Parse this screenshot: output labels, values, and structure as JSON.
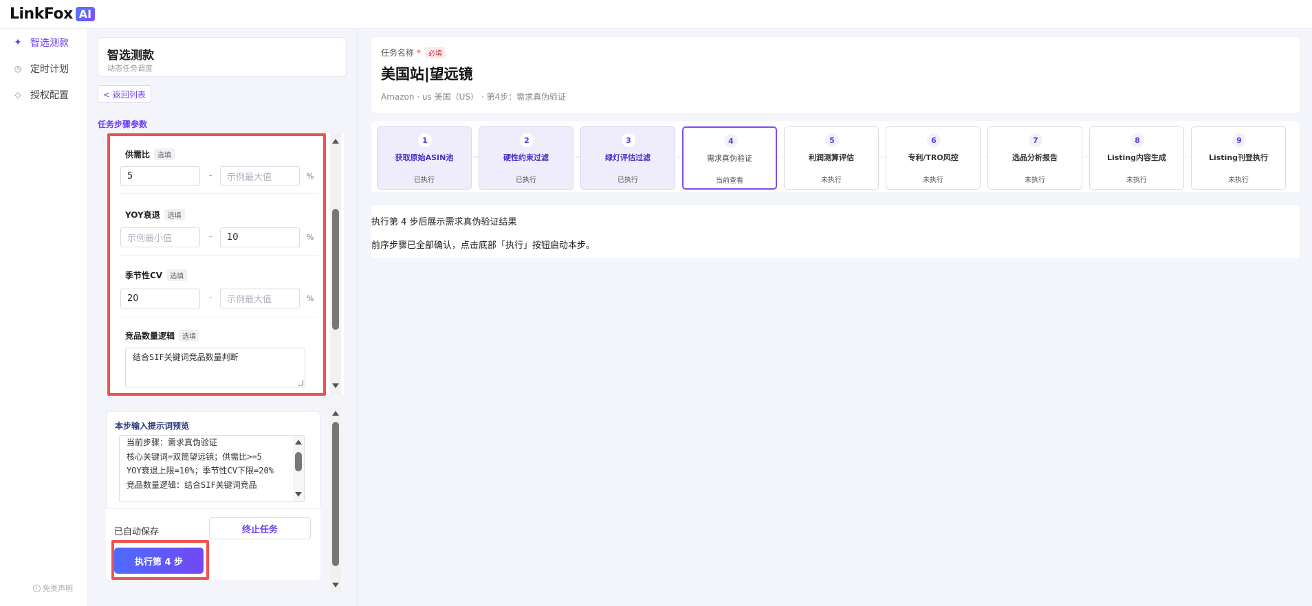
{
  "brand": {
    "name": "LinkFox",
    "badge": "AI"
  },
  "nav": {
    "items": [
      {
        "label": "智选测款",
        "icon": "sparkle-icon",
        "glyph": "✦",
        "active": true
      },
      {
        "label": "定时计划",
        "icon": "clock-icon",
        "glyph": "◷",
        "active": false
      },
      {
        "label": "授权配置",
        "icon": "diamond-icon",
        "glyph": "◇",
        "active": false
      }
    ],
    "disclaimer": "免责声明"
  },
  "task_card": {
    "title": "智选测款",
    "subtitle": "动态任务调度"
  },
  "back_button": "< 返回列表",
  "section_label": "任务步骤参数",
  "params": [
    {
      "label": "供需比",
      "tag": "选填",
      "min": "5",
      "min_placeholder": "",
      "max": "",
      "max_placeholder": "示例最大值",
      "unit": "%"
    },
    {
      "label": "YOY衰退",
      "tag": "选填",
      "min": "",
      "min_placeholder": "示例最小值",
      "max": "10",
      "max_placeholder": "",
      "unit": "%"
    },
    {
      "label": "季节性CV",
      "tag": "选填",
      "min": "20",
      "min_placeholder": "",
      "max": "",
      "max_placeholder": "示例最大值",
      "unit": "%"
    },
    {
      "label": "竞品数量逻辑",
      "tag": "选填",
      "text": "结合SIF关键词竞品数量判断"
    }
  ],
  "prompt_preview": {
    "title": "本步输入提示词预览",
    "text": "当前步骤：需求真伪验证\n核心关键词=双筒望远镜；供需比>=5\nYOY衰退上限=10%；季节性CV下限=20%\n竞品数量逻辑：结合SIF关键词竞品"
  },
  "actions": {
    "autosave": "已自动保存",
    "stop": "终止任务",
    "execute": "执行第 4 步"
  },
  "header": {
    "task_name_label": "任务名称",
    "required_star": "*",
    "required_tag": "必填",
    "task_name": "美国站|望远镜",
    "meta": "Amazon · us 美国（US） · 第4步：需求真伪验证"
  },
  "steps": [
    {
      "num": "1",
      "title": "获取原始ASIN池",
      "status": "已执行",
      "state": "done"
    },
    {
      "num": "2",
      "title": "硬性约束过滤",
      "status": "已执行",
      "state": "done"
    },
    {
      "num": "3",
      "title": "绿灯评估过滤",
      "status": "已执行",
      "state": "done"
    },
    {
      "num": "4",
      "title": "需求真伪验证",
      "status": "当前查看",
      "state": "current"
    },
    {
      "num": "5",
      "title": "利润测算评估",
      "status": "未执行",
      "state": "pending"
    },
    {
      "num": "6",
      "title": "专利/TRO风控",
      "status": "未执行",
      "state": "pending"
    },
    {
      "num": "7",
      "title": "选品分析报告",
      "status": "未执行",
      "state": "pending"
    },
    {
      "num": "8",
      "title": "Listing内容生成",
      "status": "未执行",
      "state": "pending"
    },
    {
      "num": "9",
      "title": "Listing刊登执行",
      "status": "未执行",
      "state": "pending"
    }
  ],
  "result": {
    "line1": "执行第 4 步后展示需求真伪验证结果",
    "line2": "前序步骤已全部确认，点击底部「执行」按钮启动本步。"
  },
  "colors": {
    "accent": "#6b3df5",
    "highlight": "#ef5350"
  }
}
